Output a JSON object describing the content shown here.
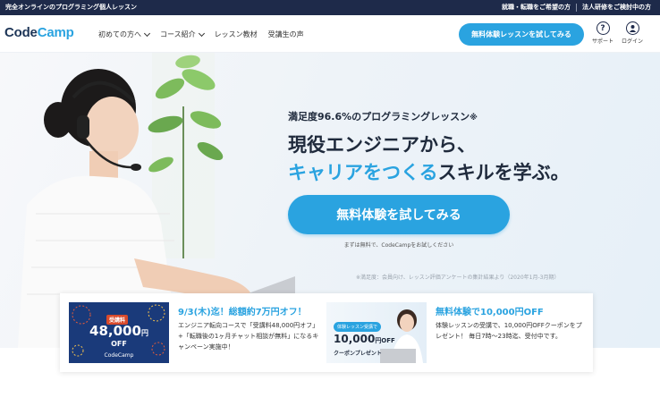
{
  "topbar": {
    "left_text": "完全オンラインのプログラミング個人レッスン",
    "right_links": [
      "就職・転職をご希望の方",
      "法人研修をご検討中の方"
    ]
  },
  "nav": {
    "logo_part1": "Code",
    "logo_part2": "Camp",
    "menu": [
      {
        "label": "初めての方へ",
        "has_dropdown": true
      },
      {
        "label": "コース紹介",
        "has_dropdown": true
      },
      {
        "label": "レッスン教材",
        "has_dropdown": false
      },
      {
        "label": "受講生の声",
        "has_dropdown": false
      }
    ],
    "cta_label": "無料体験レッスンを試してみる",
    "support_icon": "question-circle-icon",
    "support_label": "サポート",
    "login_icon": "user-circle-icon",
    "login_label": "ログイン"
  },
  "hero": {
    "satisfaction": "満足度96.6%のプログラミングレッスン",
    "satisfaction_mark": "※",
    "headline_line1": "現役エンジニアから、",
    "headline_line2_blue": "キャリアをつくる",
    "headline_line2_rest": "スキルを学ぶ。",
    "cta_label": "無料体験を試してみる",
    "cta_note": "まずは無料で、CodeCampをお試しください",
    "footnote": "※満足度：会員向け、レッスン評価アンケートの集計結果より（2020年1月-3月期）"
  },
  "promos": {
    "promo1": {
      "banner_label": "受講料",
      "banner_amount": "48,000",
      "banner_unit": "円",
      "banner_off": "OFF",
      "banner_brand": "CodeCamp",
      "title": "9/3(木)迄！総額約7万円オフ！",
      "body": "エンジニア転向コースで「受講料48,000円オフ」+「転職後の1ヶ月チャット相談が無料」になるキャンペーン実施中！"
    },
    "promo2": {
      "banner_tag": "体験レッスン受講で",
      "banner_amount": "10,000",
      "banner_unit": "円OFF",
      "banner_sub": "クーポンプレゼント",
      "title": "無料体験で10,000円OFF",
      "body": "体験レッスンの受講で、10,000円OFFクーポンをプレゼント！ 毎日7時〜23時迄、受付中です。"
    }
  },
  "colors": {
    "accent": "#2aa3e0",
    "topbar": "#1e2a4a",
    "text": "#1f2a3c"
  }
}
